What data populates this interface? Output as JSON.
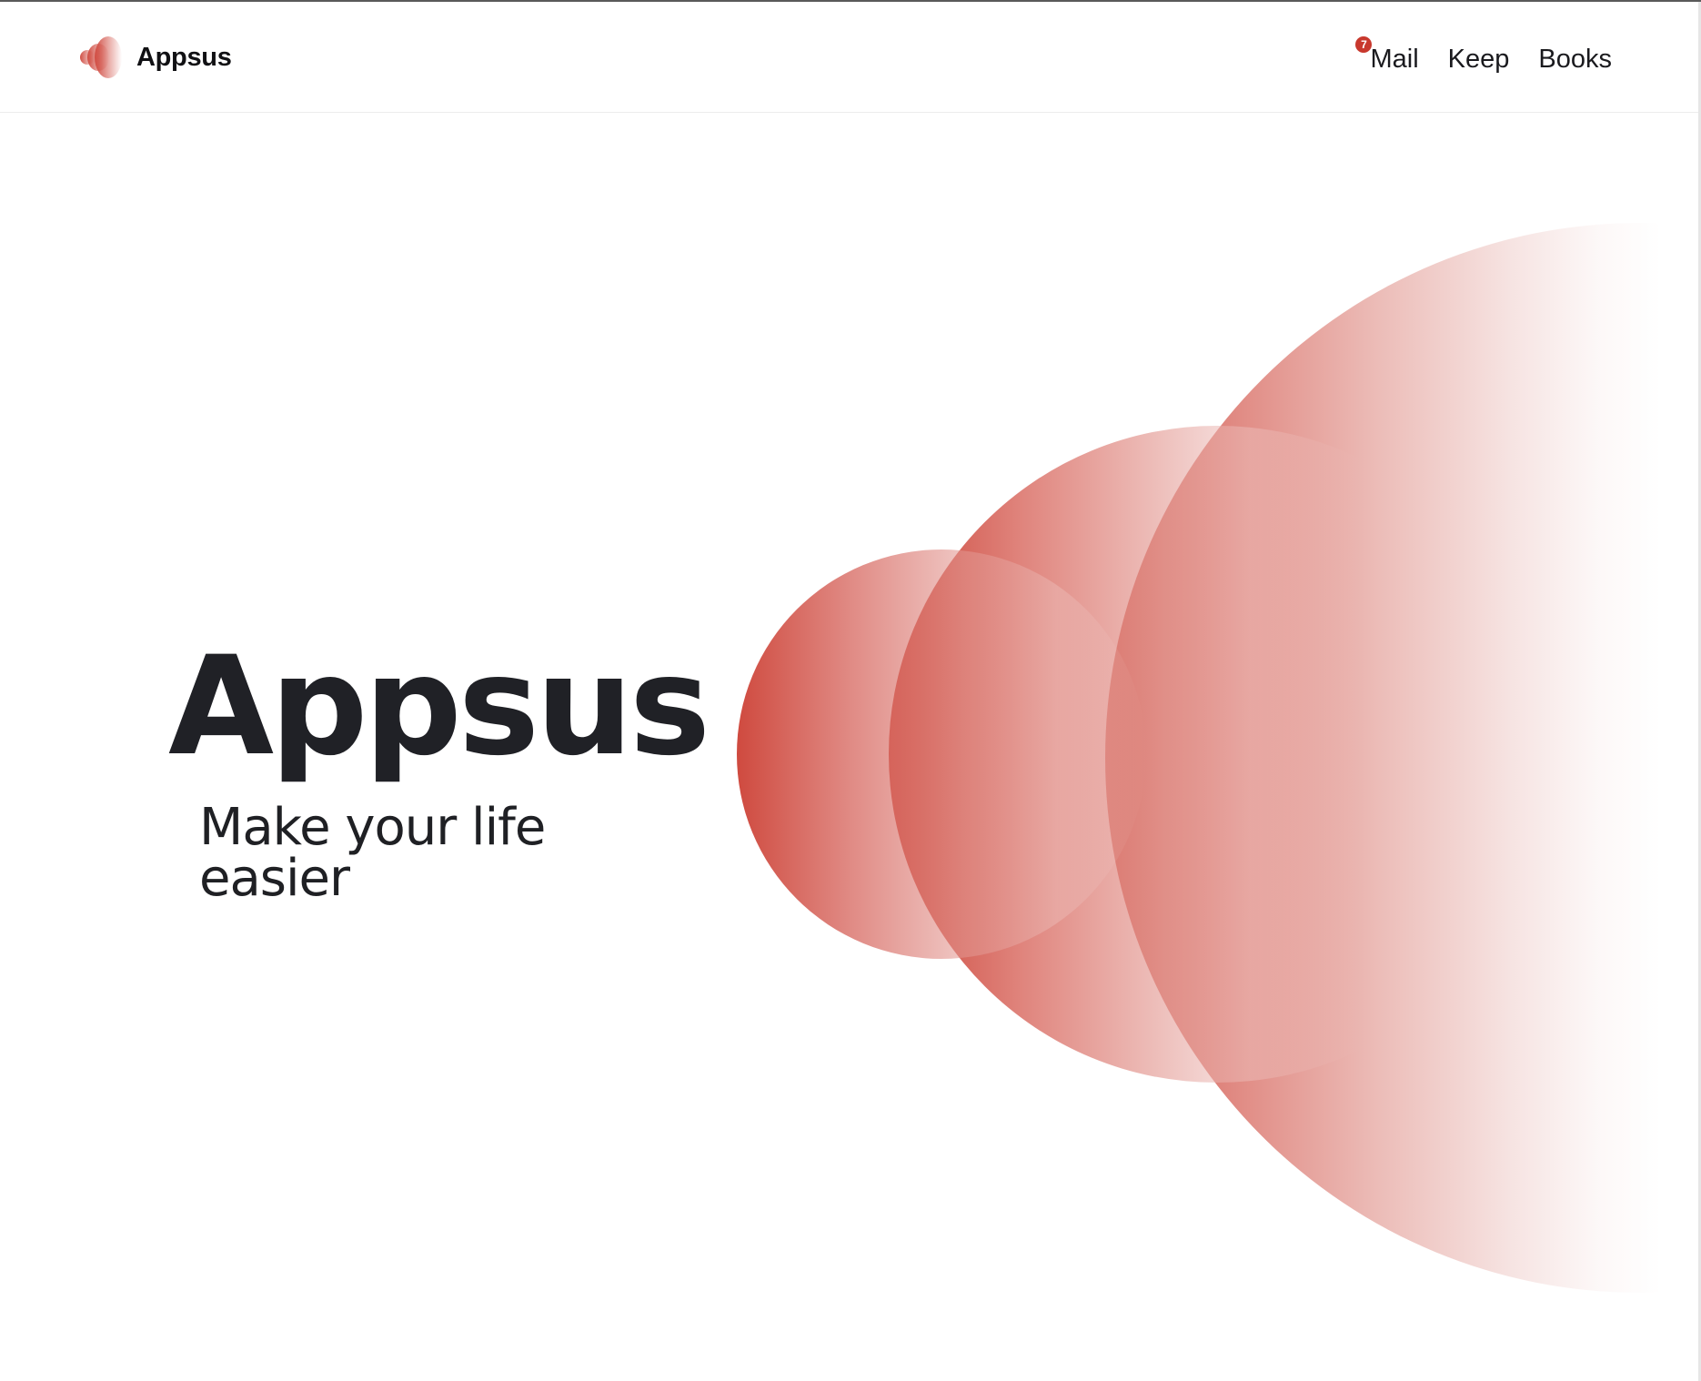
{
  "header": {
    "brand_name": "Appsus",
    "nav": [
      {
        "label": "Mail",
        "badge": "7"
      },
      {
        "label": "Keep"
      },
      {
        "label": "Books"
      }
    ]
  },
  "hero": {
    "title": "Appsus",
    "subtitle": "Make your life easier"
  },
  "colors": {
    "accent": "#cf4a3f",
    "text": "#202126",
    "badge": "#c8382d"
  }
}
